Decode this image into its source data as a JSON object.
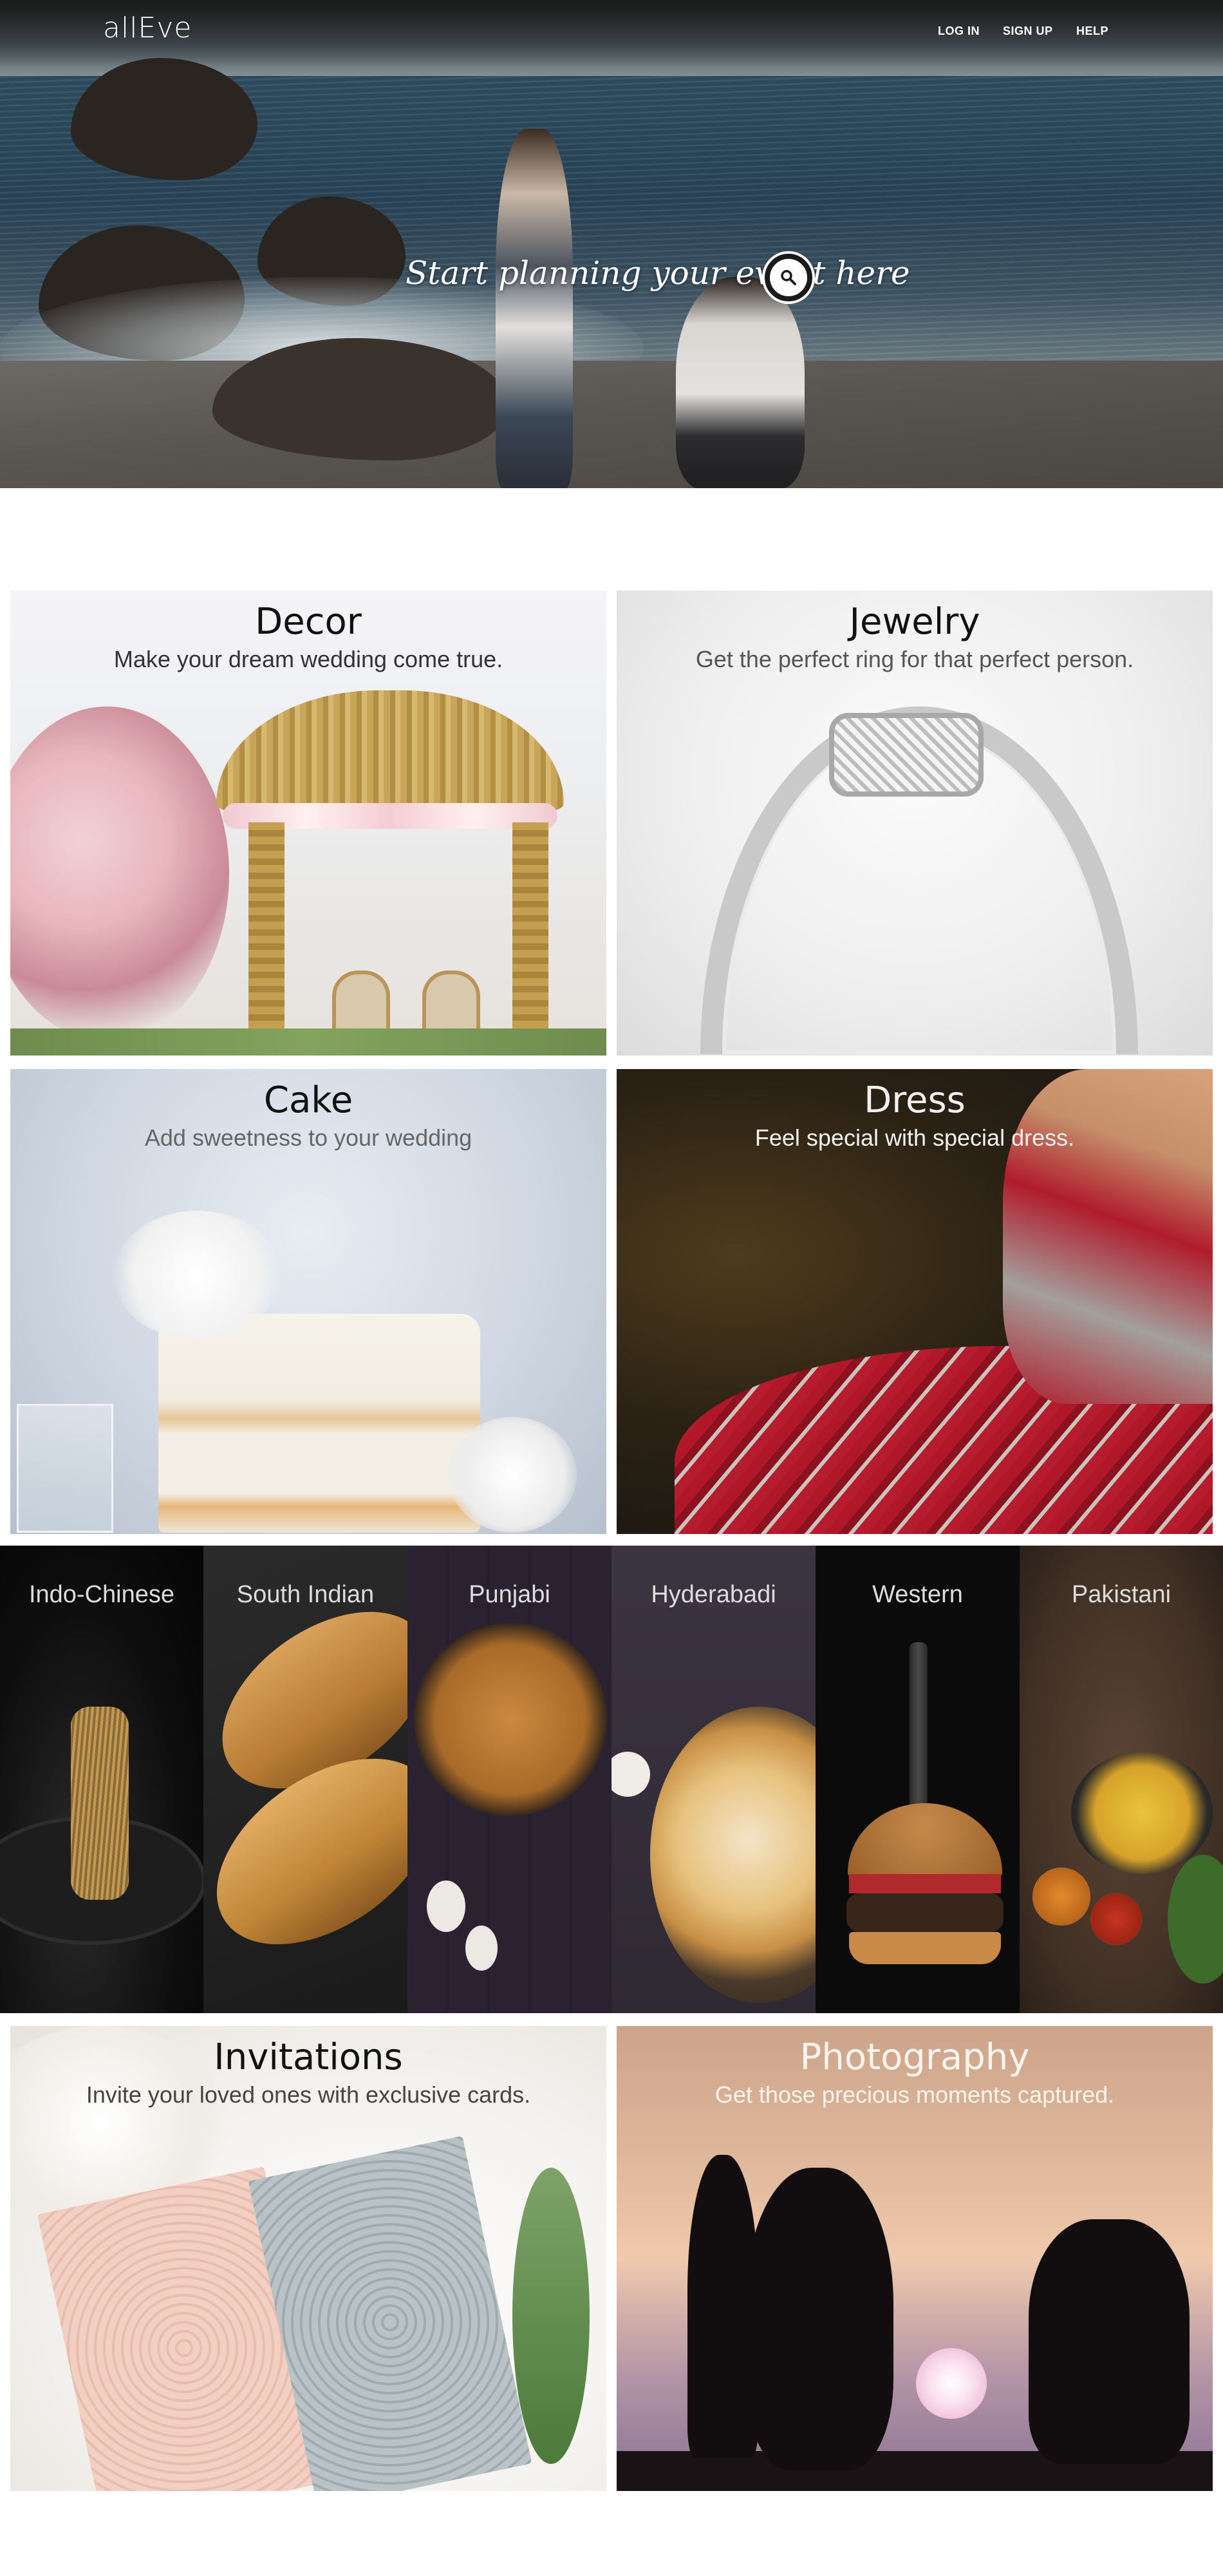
{
  "header": {
    "logo": "allEve",
    "nav": {
      "login": "LOG IN",
      "signup": "SIGN UP",
      "help": "HELP"
    }
  },
  "hero": {
    "tagline": "Start planning your event here",
    "search_icon": "search-icon"
  },
  "categories": [
    {
      "title": "Decor",
      "subtitle": "Make your dream wedding come true."
    },
    {
      "title": "Jewelry",
      "subtitle": "Get the perfect ring for that perfect person."
    },
    {
      "title": "Cake",
      "subtitle": "Add sweetness to your wedding"
    },
    {
      "title": "Dress",
      "subtitle": "Feel special with special dress."
    }
  ],
  "cuisines": [
    "Indo-Chinese",
    "South Indian",
    "Punjabi",
    "Hyderabadi",
    "Western",
    "Pakistani"
  ],
  "bottom_categories": [
    {
      "title": "Invitations",
      "subtitle": "Invite your loved ones with exclusive cards."
    },
    {
      "title": "Photography",
      "subtitle": "Get those precious moments captured."
    }
  ]
}
